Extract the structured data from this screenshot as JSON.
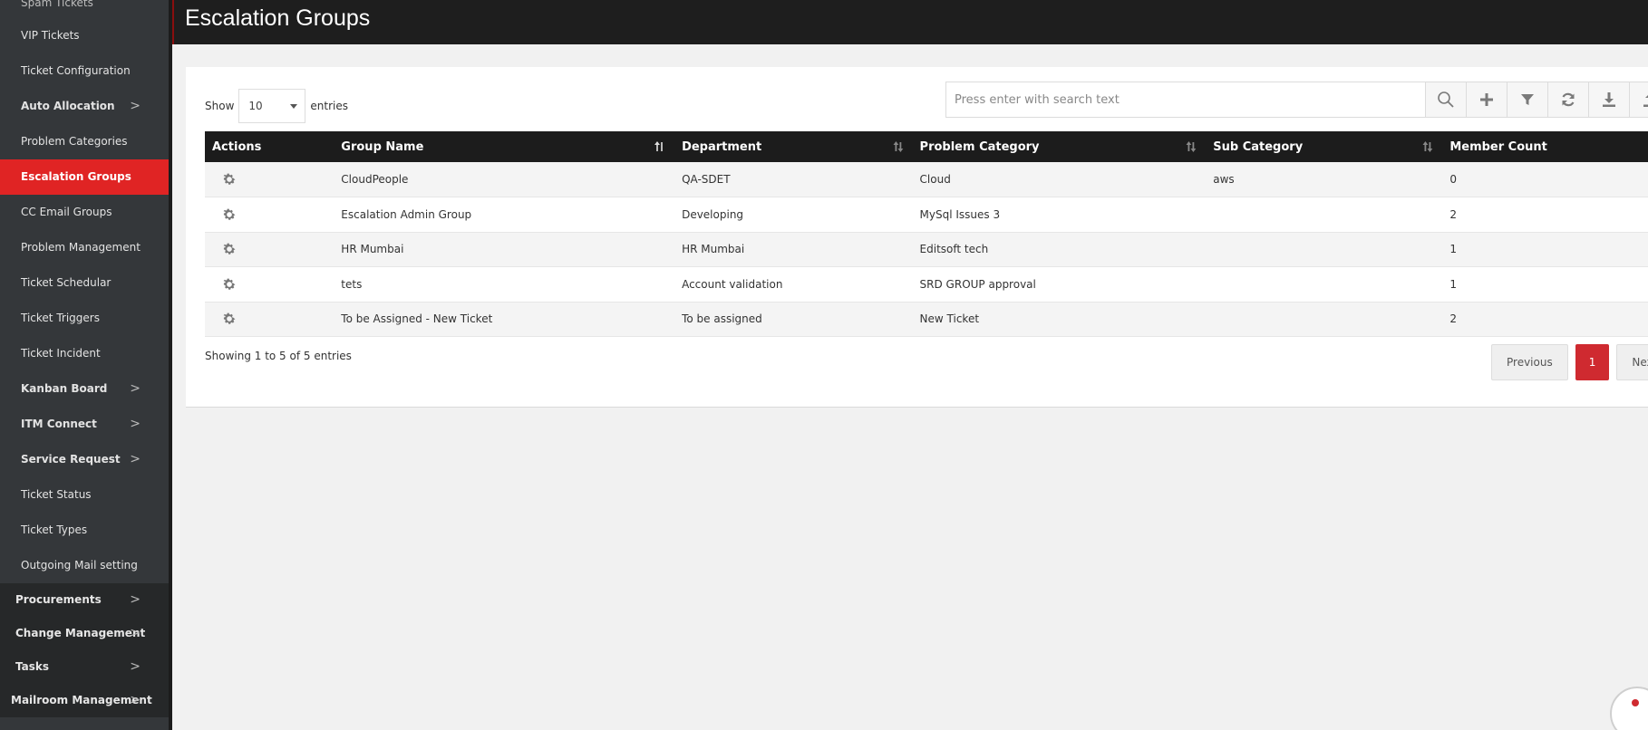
{
  "sidebar": {
    "items": [
      {
        "label": "Spam Tickets"
      },
      {
        "label": "VIP Tickets"
      },
      {
        "label": "Ticket Configuration"
      },
      {
        "label": "Auto Allocation",
        "chevron": ">"
      },
      {
        "label": "Problem Categories"
      },
      {
        "label": "Escalation Groups"
      },
      {
        "label": "CC Email Groups"
      },
      {
        "label": "Problem Management"
      },
      {
        "label": "Ticket Schedular"
      },
      {
        "label": "Ticket Triggers"
      },
      {
        "label": "Ticket Incident"
      },
      {
        "label": "Kanban Board",
        "chevron": ">"
      },
      {
        "label": "ITM Connect",
        "chevron": ">"
      },
      {
        "label": "Service Request",
        "chevron": ">"
      },
      {
        "label": "Ticket Status"
      },
      {
        "label": "Ticket Types"
      },
      {
        "label": "Outgoing Mail setting"
      }
    ],
    "top_items": [
      {
        "label": "Procurements",
        "chevron": ">"
      },
      {
        "label": "Change Management",
        "chevron": ">"
      },
      {
        "label": "Tasks",
        "chevron": ">"
      },
      {
        "label": "Mailroom Management",
        "chevron": ">"
      }
    ]
  },
  "header": {
    "title": "Escalation Groups"
  },
  "entries": {
    "show_label": "Show",
    "value": "10",
    "entries_label": "entries"
  },
  "search": {
    "placeholder": "Press enter with search text"
  },
  "toolbar": {
    "icons": [
      "search-icon",
      "plus-icon",
      "filter-icon",
      "refresh-icon",
      "download-icon",
      "upload-icon"
    ]
  },
  "table": {
    "columns": [
      "Actions",
      "Group Name",
      "Department",
      "Problem Category",
      "Sub Category",
      "Member Count"
    ],
    "rows": [
      {
        "group": "CloudPeople",
        "department": "QA-SDET",
        "category": "Cloud",
        "sub": "aws",
        "members": "0"
      },
      {
        "group": "Escalation Admin Group",
        "department": "Developing",
        "category": "MySql Issues 3",
        "sub": "",
        "members": "2"
      },
      {
        "group": "HR Mumbai",
        "department": "HR Mumbai",
        "category": "Editsoft tech",
        "sub": "",
        "members": "1"
      },
      {
        "group": "tets",
        "department": "Account validation",
        "category": "SRD GROUP approval",
        "sub": "",
        "members": "1"
      },
      {
        "group": "To be Assigned - New Ticket",
        "department": "To be assigned",
        "category": "New Ticket",
        "sub": "",
        "members": "2"
      }
    ]
  },
  "footer": {
    "showing": "Showing 1 to 5 of 5 entries"
  },
  "pagination": {
    "previous": "Previous",
    "current": "1",
    "next": "Next"
  },
  "colors": {
    "accent": "#e02424",
    "header_bg": "#1e1e1e",
    "sidebar_bg": "#34373a"
  }
}
